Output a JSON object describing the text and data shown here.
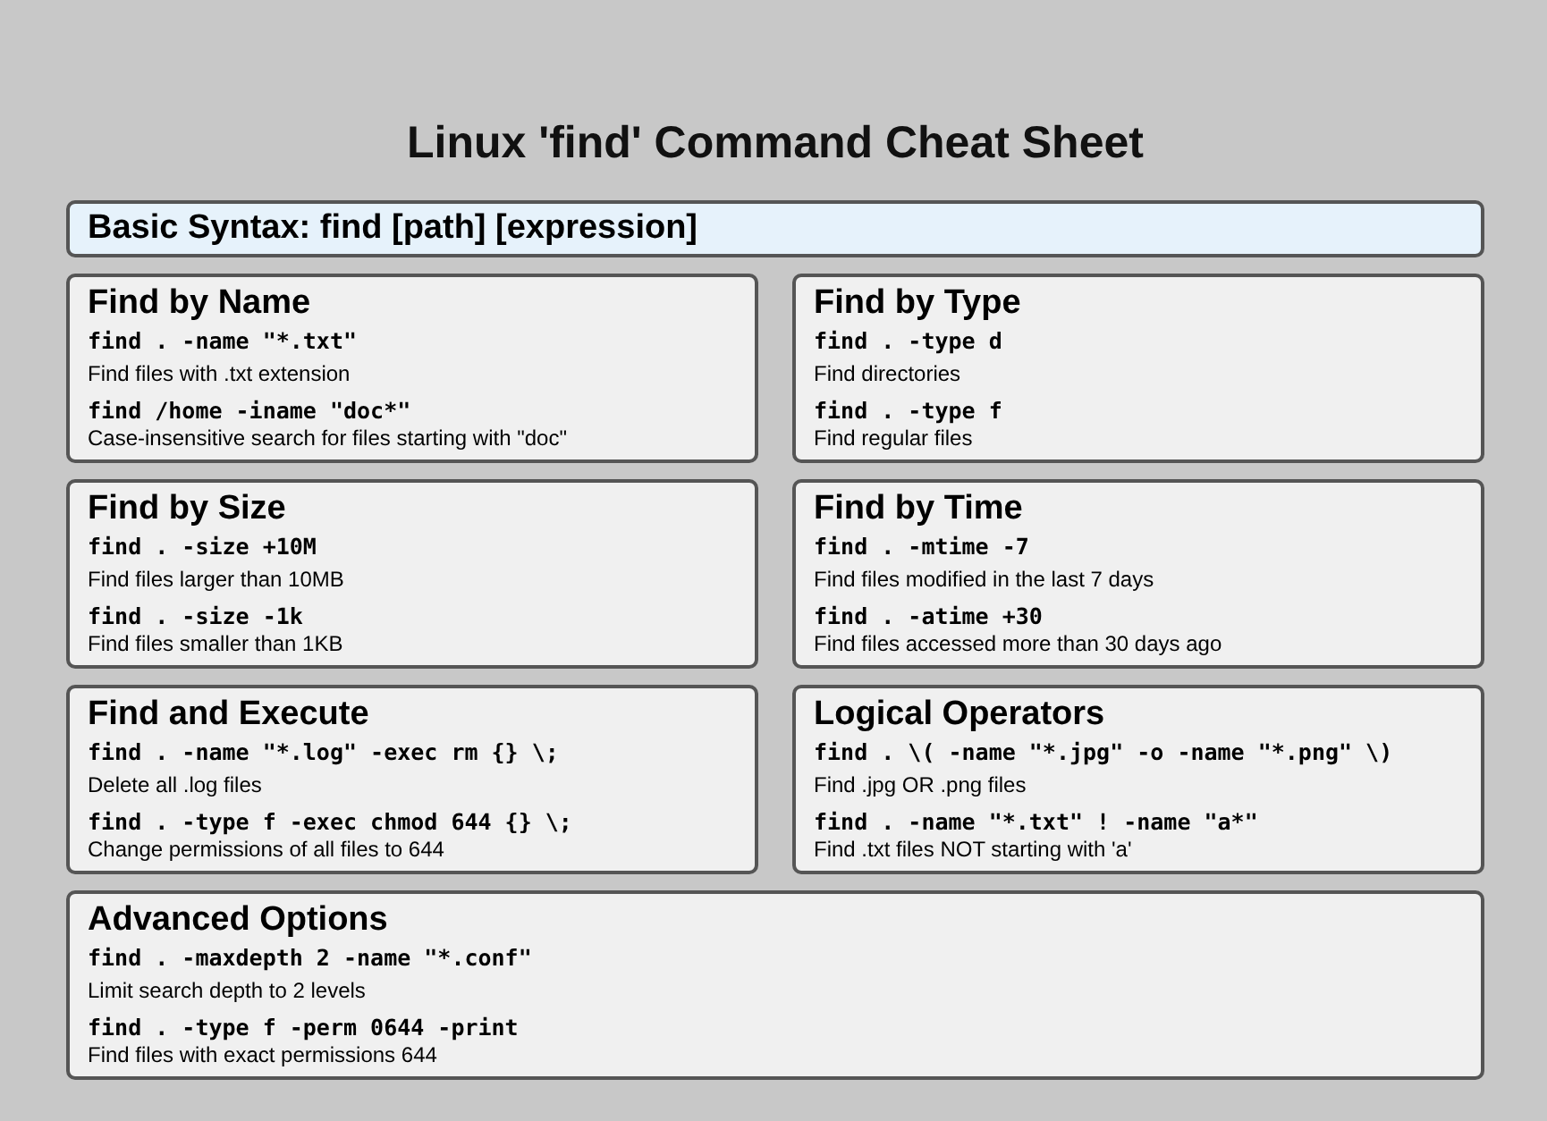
{
  "title": "Linux 'find' Command Cheat Sheet",
  "syntax": "Basic Syntax: find [path] [expression]",
  "sections": [
    {
      "kind": "half",
      "heading": "Find by Name",
      "examples": [
        {
          "command": "find . -name \"*.txt\"",
          "description": "Find files with .txt extension"
        },
        {
          "command": "find /home -iname \"doc*\"",
          "description": "Case-insensitive search for files starting with \"doc\""
        }
      ]
    },
    {
      "kind": "half",
      "heading": "Find by Type",
      "examples": [
        {
          "command": "find . -type d",
          "description": "Find directories"
        },
        {
          "command": "find . -type f",
          "description": "Find regular files"
        }
      ]
    },
    {
      "kind": "half",
      "heading": "Find by Size",
      "examples": [
        {
          "command": "find . -size +10M",
          "description": "Find files larger than 10MB"
        },
        {
          "command": "find . -size -1k",
          "description": "Find files smaller than 1KB"
        }
      ]
    },
    {
      "kind": "half",
      "heading": "Find by Time",
      "examples": [
        {
          "command": "find . -mtime -7",
          "description": "Find files modified in the last 7 days"
        },
        {
          "command": "find . -atime +30",
          "description": "Find files accessed more than 30 days ago"
        }
      ]
    },
    {
      "kind": "half",
      "heading": "Find and Execute",
      "examples": [
        {
          "command": "find . -name \"*.log\" -exec rm {} \\;",
          "description": "Delete all .log files"
        },
        {
          "command": "find . -type f -exec chmod 644 {} \\;",
          "description": "Change permissions of all files to 644"
        }
      ]
    },
    {
      "kind": "half",
      "heading": "Logical Operators",
      "examples": [
        {
          "command": "find . \\( -name \"*.jpg\" -o -name \"*.png\" \\)",
          "description": "Find .jpg OR .png files"
        },
        {
          "command": "find . -name \"*.txt\" ! -name \"a*\"",
          "description": "Find .txt files NOT starting with 'a'"
        }
      ]
    },
    {
      "kind": "wide",
      "heading": "Advanced Options",
      "examples": [
        {
          "command": "find . -maxdepth 2 -name \"*.conf\"",
          "description": "Limit search depth to 2 levels"
        },
        {
          "command": "find . -type f -perm 0644 -print",
          "description": "Find files with exact permissions 644"
        }
      ]
    }
  ]
}
